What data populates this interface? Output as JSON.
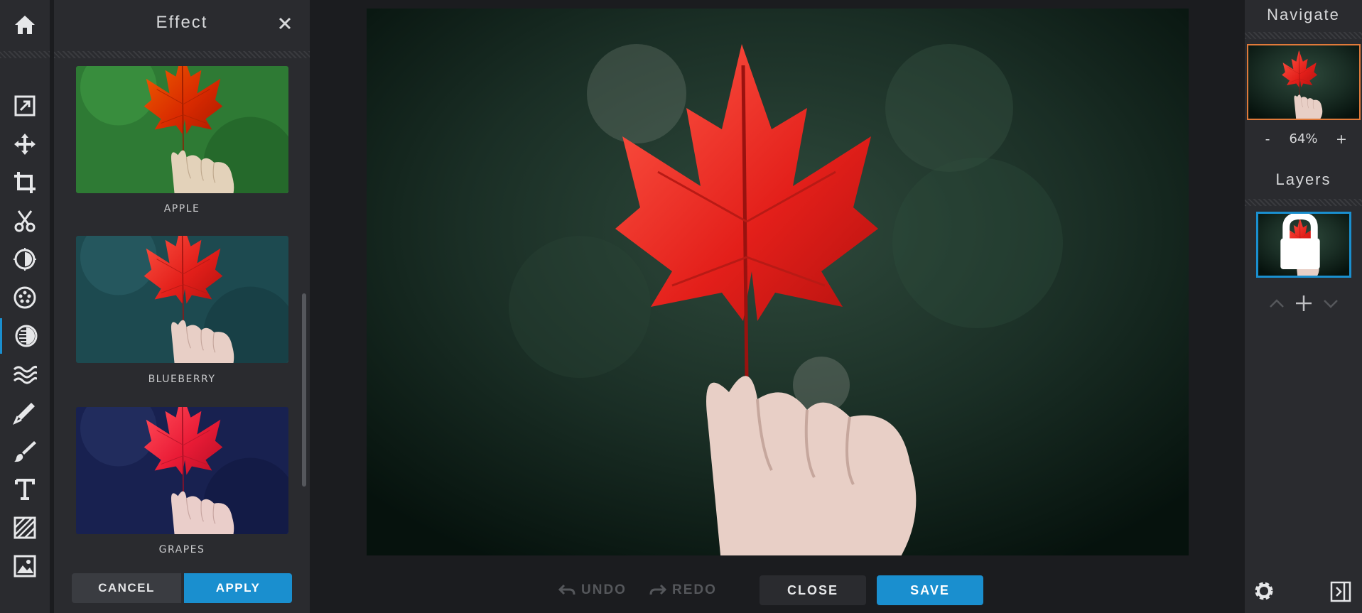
{
  "toolbar": {
    "home_icon": "home-icon",
    "tools": [
      {
        "name": "tool-edit",
        "icon": "edit-icon"
      },
      {
        "name": "tool-move",
        "icon": "move-icon"
      },
      {
        "name": "tool-crop",
        "icon": "crop-icon"
      },
      {
        "name": "tool-cut",
        "icon": "scissors-icon"
      },
      {
        "name": "tool-adjust",
        "icon": "brightness-icon"
      },
      {
        "name": "tool-filter",
        "icon": "dots-circle-icon"
      },
      {
        "name": "tool-effect",
        "icon": "effect-icon",
        "active": true
      },
      {
        "name": "tool-distort",
        "icon": "waves-icon"
      },
      {
        "name": "tool-draw",
        "icon": "pen-icon"
      },
      {
        "name": "tool-brush",
        "icon": "brush-icon"
      },
      {
        "name": "tool-text",
        "icon": "text-icon"
      },
      {
        "name": "tool-pattern",
        "icon": "hatch-icon"
      },
      {
        "name": "tool-image",
        "icon": "image-icon"
      }
    ],
    "accent": "#1a8fcf"
  },
  "effect_panel": {
    "title": "Effect",
    "close_icon": "close-icon",
    "effects": [
      {
        "label": "APPLE",
        "tint": "#2a8a3a"
      },
      {
        "label": "BLUEBERRY",
        "tint": "#1f5a5e"
      },
      {
        "label": "GRAPES",
        "tint": "#1a2550"
      }
    ],
    "cancel_label": "CANCEL",
    "apply_label": "APPLY"
  },
  "bottom_bar": {
    "undo_label": "UNDO",
    "redo_label": "REDO",
    "close_label": "CLOSE",
    "save_label": "SAVE"
  },
  "right_panel": {
    "navigate_title": "Navigate",
    "zoom_minus": "-",
    "zoom_value": "64%",
    "zoom_plus": "+",
    "layers_title": "Layers"
  },
  "colors": {
    "accent": "#1a8fcf",
    "nav_border": "#e07a3a",
    "panel_bg": "#2a2b2f",
    "app_bg": "#1b1c1f"
  }
}
